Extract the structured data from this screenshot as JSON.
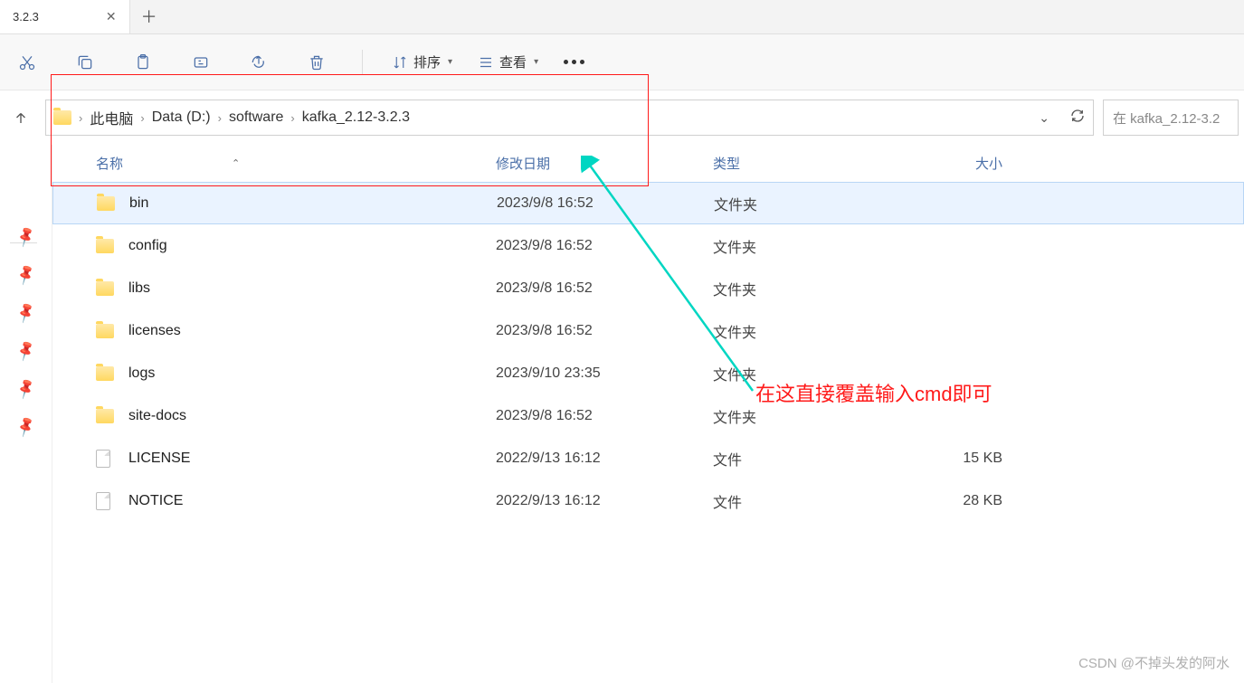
{
  "tab": {
    "title": "3.2.3"
  },
  "toolbar": {
    "sort_label": "排序",
    "view_label": "查看"
  },
  "breadcrumbs": {
    "items": [
      "此电脑",
      "Data (D:)",
      "software",
      "kafka_2.12-3.2.3"
    ]
  },
  "search": {
    "placeholder": "在 kafka_2.12-3.2"
  },
  "columns": {
    "name": "名称",
    "date": "修改日期",
    "type": "类型",
    "size": "大小"
  },
  "files": [
    {
      "name": "bin",
      "date": "2023/9/8 16:52",
      "type": "文件夹",
      "size": "",
      "kind": "folder",
      "selected": true
    },
    {
      "name": "config",
      "date": "2023/9/8 16:52",
      "type": "文件夹",
      "size": "",
      "kind": "folder",
      "selected": false
    },
    {
      "name": "libs",
      "date": "2023/9/8 16:52",
      "type": "文件夹",
      "size": "",
      "kind": "folder",
      "selected": false
    },
    {
      "name": "licenses",
      "date": "2023/9/8 16:52",
      "type": "文件夹",
      "size": "",
      "kind": "folder",
      "selected": false
    },
    {
      "name": "logs",
      "date": "2023/9/10 23:35",
      "type": "文件夹",
      "size": "",
      "kind": "folder",
      "selected": false
    },
    {
      "name": "site-docs",
      "date": "2023/9/8 16:52",
      "type": "文件夹",
      "size": "",
      "kind": "folder",
      "selected": false
    },
    {
      "name": "LICENSE",
      "date": "2022/9/13 16:12",
      "type": "文件",
      "size": "15 KB",
      "kind": "file",
      "selected": false
    },
    {
      "name": "NOTICE",
      "date": "2022/9/13 16:12",
      "type": "文件",
      "size": "28 KB",
      "kind": "file",
      "selected": false
    }
  ],
  "annotation": {
    "text": "在这直接覆盖输入cmd即可",
    "arrow_color": "#00d6c2"
  },
  "watermark": "CSDN @不掉头发的阿水"
}
